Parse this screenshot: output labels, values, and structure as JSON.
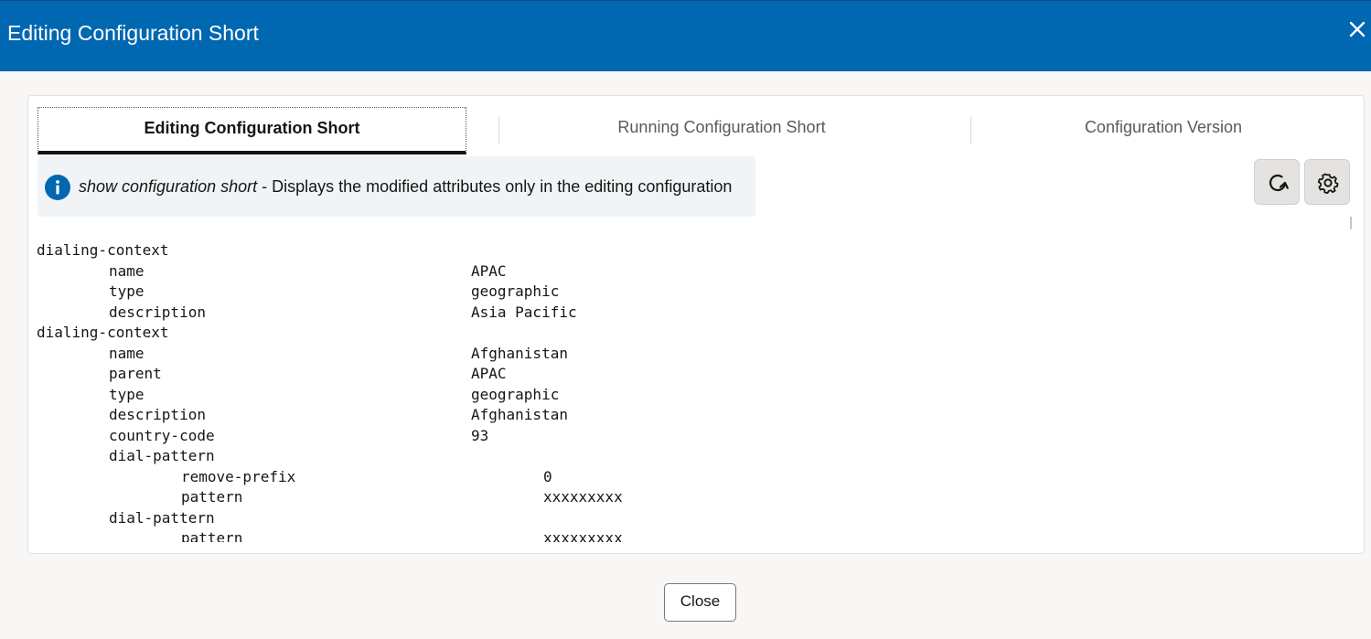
{
  "dialog": {
    "title": "Editing Configuration Short",
    "close_button_label": "Close"
  },
  "tabs": [
    {
      "label": "Editing Configuration Short",
      "active": true
    },
    {
      "label": "Running Configuration Short",
      "active": false
    },
    {
      "label": "Configuration Version",
      "active": false
    }
  ],
  "info_banner": {
    "command": "show configuration short",
    "separator": " - ",
    "description": "Displays the modified attributes only in the editing configuration",
    "icon": "info-icon"
  },
  "toolbar": {
    "refresh_icon": "refresh-icon",
    "settings_icon": "gear-icon"
  },
  "config_lines": [
    {
      "key": "dialing-context",
      "value": "",
      "level": 0
    },
    {
      "key": "name",
      "value": "APAC",
      "level": 1
    },
    {
      "key": "type",
      "value": "geographic",
      "level": 1
    },
    {
      "key": "description",
      "value": "Asia Pacific",
      "level": 1
    },
    {
      "key": "dialing-context",
      "value": "",
      "level": 0
    },
    {
      "key": "name",
      "value": "Afghanistan",
      "level": 1
    },
    {
      "key": "parent",
      "value": "APAC",
      "level": 1
    },
    {
      "key": "type",
      "value": "geographic",
      "level": 1
    },
    {
      "key": "description",
      "value": "Afghanistan",
      "level": 1
    },
    {
      "key": "country-code",
      "value": "93",
      "level": 1
    },
    {
      "key": "dial-pattern",
      "value": "",
      "level": 1
    },
    {
      "key": "remove-prefix",
      "value": "0",
      "level": 2
    },
    {
      "key": "pattern",
      "value": "xxxxxxxxx",
      "level": 2
    },
    {
      "key": "dial-pattern",
      "value": "",
      "level": 1
    },
    {
      "key": "pattern",
      "value": "xxxxxxxxx",
      "level": 2
    }
  ],
  "colors": {
    "header_bg": "#0067b1",
    "info_icon": "#0067b1",
    "page_bg": "#f8f7f5"
  }
}
